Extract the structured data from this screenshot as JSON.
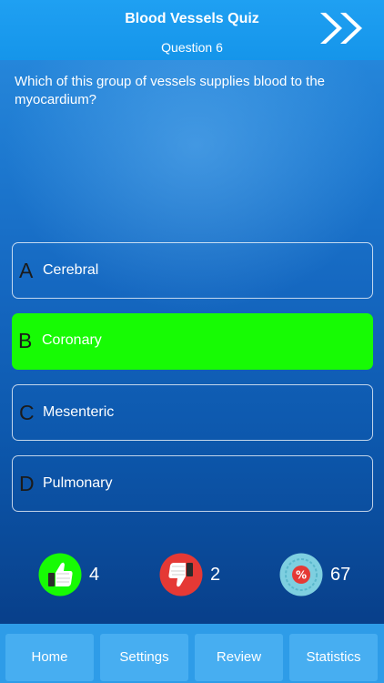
{
  "header": {
    "title": "Blood Vessels Quiz",
    "subtitle": "Question 6",
    "next_icon": "double-chevron-right-icon"
  },
  "question": {
    "text": "Which of this group of vessels supplies blood to the myocardium?"
  },
  "answers": [
    {
      "letter": "A",
      "text": "Cerebral",
      "state": "default"
    },
    {
      "letter": "B",
      "text": "Coronary",
      "state": "correct"
    },
    {
      "letter": "C",
      "text": "Mesenteric",
      "state": "default"
    },
    {
      "letter": "D",
      "text": "Pulmonary",
      "state": "default"
    }
  ],
  "stats": {
    "correct": {
      "icon": "thumbs-up-icon",
      "value": "4",
      "color": "#17fb04"
    },
    "wrong": {
      "icon": "thumbs-down-icon",
      "value": "2",
      "color": "#e53935"
    },
    "percent": {
      "icon": "percent-badge-icon",
      "value": "67",
      "color": "#7ecfe0"
    }
  },
  "tabs": [
    {
      "label": "Home"
    },
    {
      "label": "Settings"
    },
    {
      "label": "Review"
    },
    {
      "label": "Statistics"
    }
  ],
  "colors": {
    "header": "#1595ea",
    "correct_answer": "#17fb04",
    "tab_button": "#47aef1",
    "tab_bar": "#2e9ce8"
  }
}
